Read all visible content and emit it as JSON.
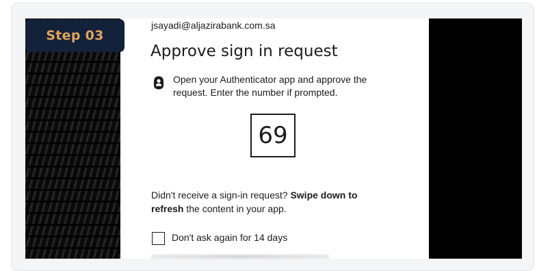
{
  "step_badge": {
    "label": "Step 03",
    "bg_color": "#14213a",
    "text_color": "#e2a55c"
  },
  "signin": {
    "email": "jsayadi@aljazirabank.com.sa",
    "title": "Approve sign in request",
    "instruction": "Open your Authenticator app and approve the request. Enter the number if prompted.",
    "number": "69",
    "refresh_prefix": "Didn't receive a sign-in request? ",
    "refresh_bold1": "Swipe down to",
    "refresh_bold2": "refresh",
    "refresh_suffix": " the content in your app.",
    "dont_ask_label": "Don't ask again for 14 days",
    "dont_ask_checked": false
  },
  "icons": {
    "authenticator": "lock-person-icon"
  }
}
